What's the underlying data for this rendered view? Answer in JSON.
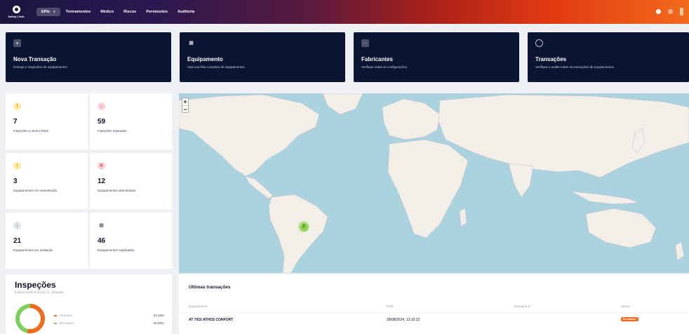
{
  "app": {
    "logo_text": "Safety | Hub"
  },
  "nav": {
    "items": [
      {
        "label": "EPIs",
        "dropdown": true,
        "active": true
      },
      {
        "label": "Treinamentos"
      },
      {
        "label": "Médico"
      },
      {
        "label": "Riscos"
      },
      {
        "label": "Permissões"
      },
      {
        "label": "Auditoria"
      }
    ],
    "dropdown_icon": "chevron-down-icon"
  },
  "actions": [
    {
      "title": "Nova Transação",
      "description": "Entrega e inspeções de equipamentos",
      "icon": "plus-icon"
    },
    {
      "title": "Equipamento",
      "description": "Veja sua lista completa de equipamentos",
      "icon": "grid-icon"
    },
    {
      "title": "Fabricantes",
      "description": "Verifique todas as configurações",
      "icon": "more-icon"
    },
    {
      "title": "Transações",
      "description": "Verifique e audite todas as transações de equipamentos",
      "icon": "search-icon"
    }
  ],
  "stats": [
    {
      "value": "7",
      "label": "Inspeções a serem feitas",
      "icon": "warning-icon"
    },
    {
      "value": "59",
      "label": "Inspeções expiradas",
      "icon": "expired-icon"
    },
    {
      "value": "3",
      "label": "Equipamentos em manutenção",
      "icon": "warning-icon"
    },
    {
      "value": "12",
      "label": "Equipamentos descartados",
      "icon": "close-icon"
    },
    {
      "value": "21",
      "label": "Equipamentos em avaliação",
      "icon": "evaluation-icon"
    },
    {
      "value": "46",
      "label": "Equipamentos registrados",
      "icon": "grid-icon"
    }
  ],
  "map": {
    "zoom_in": "+",
    "zoom_out": "−",
    "cluster_count": "2"
  },
  "inspections": {
    "title": "Inspeções",
    "subtitle": "Inspecionado a tempo vs. atrasado",
    "legend": [
      {
        "label": "Atrasado",
        "percent": "53.15%",
        "color": "#f26a1c"
      },
      {
        "label": "Em tempo",
        "percent": "46.85%",
        "color": "#7ccf5a"
      }
    ]
  },
  "transactions": {
    "title": "Últimas transações",
    "columns": [
      "Equipamento",
      "Data",
      "Entregue a",
      "Status"
    ],
    "rows": [
      {
        "equipment": "AT 7015 ATHOS CONFORT",
        "date": "28/08/2024, 13:10:22",
        "delivered_to": "",
        "status": "Em aberto"
      }
    ]
  }
}
